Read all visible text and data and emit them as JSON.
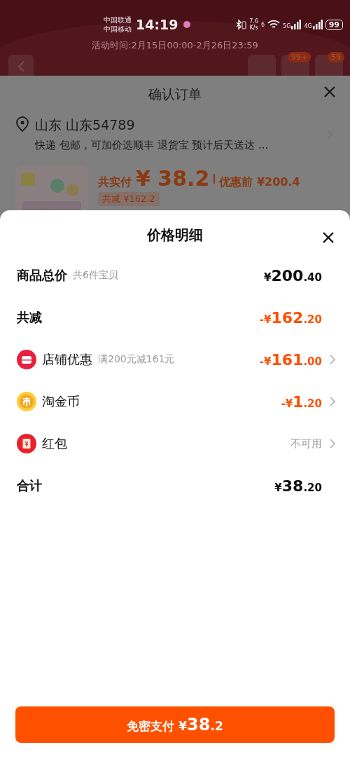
{
  "status_bar": {
    "carriers": [
      "中国联通",
      "中国移动"
    ],
    "time": "14:19",
    "speed": "7.6",
    "speed_unit": "K/s",
    "wifi_badge": "6",
    "sim1": "5G",
    "sim2": "4G",
    "battery": "99"
  },
  "background_page": {
    "activity_time": "活动时间:2月15日00:00-2月26日23:59",
    "cart_badge": "99+",
    "message_badge": "59"
  },
  "order_sheet": {
    "title": "确认订单",
    "address": "山东 山东54789",
    "delivery": "快递 包邮，可加价选顺丰 退货宝 预计后天送达 ...",
    "paid_label": "共实付",
    "paid_amount": "¥ 38.2",
    "original_label": "优惠前 ¥200.4",
    "saved": "共减 ¥162.2"
  },
  "price_detail": {
    "title": "价格明细",
    "rows": [
      {
        "kind": "line",
        "label": "商品总价",
        "note": "共6件宝贝",
        "amount": {
          "text": "¥200.40",
          "kind": "normal"
        },
        "has_arrow": false
      },
      {
        "kind": "line",
        "label": "共减",
        "amount": {
          "text": "-¥162.20",
          "kind": "discount"
        },
        "has_arrow": false
      },
      {
        "kind": "shop_coupon",
        "label": "店铺优惠",
        "note": "满200元减161元",
        "amount": {
          "text": "-¥161.00",
          "kind": "discount"
        },
        "has_arrow": true
      },
      {
        "kind": "coins",
        "label": "淘金币",
        "amount": {
          "text": "-¥1.20",
          "kind": "discount"
        },
        "has_arrow": true
      },
      {
        "kind": "red_packet",
        "label": "红包",
        "amount": {
          "text": "不可用",
          "kind": "muted"
        },
        "has_arrow": true
      },
      {
        "kind": "line",
        "label": "合计",
        "amount": {
          "text": "¥38.20",
          "kind": "normal"
        },
        "has_arrow": false
      }
    ]
  },
  "pay_button": "免密支付 ¥38.2"
}
